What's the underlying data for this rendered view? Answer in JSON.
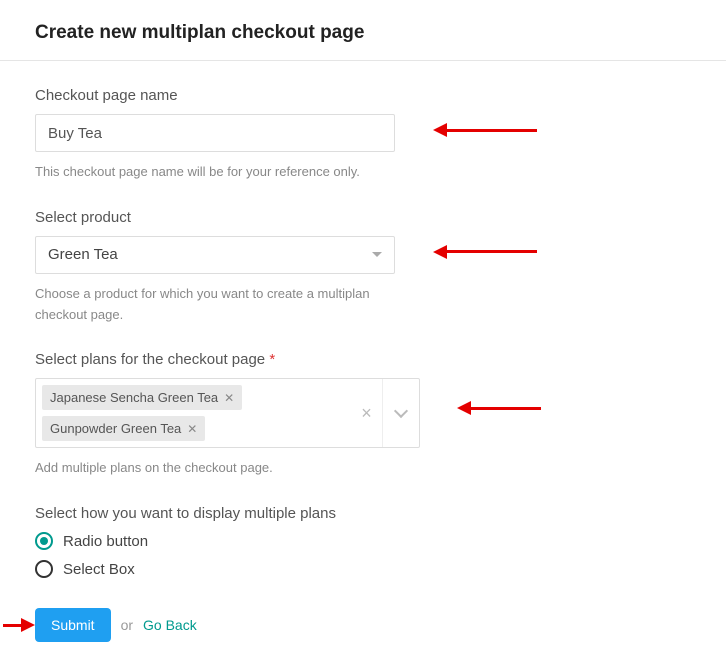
{
  "title": "Create new multiplan checkout page",
  "fields": {
    "name": {
      "label": "Checkout page name",
      "value": "Buy Tea",
      "helper": "This checkout page name will be for your reference only."
    },
    "product": {
      "label": "Select product",
      "value": "Green Tea",
      "helper": "Choose a product for which you want to create a multiplan checkout page."
    },
    "plans": {
      "label": "Select plans for the checkout page",
      "required_mark": "*",
      "tags": [
        "Japanese Sencha Green Tea",
        "Gunpowder Green Tea"
      ],
      "helper": "Add multiple plans on the checkout page."
    },
    "display": {
      "label": "Select how you want to display multiple plans",
      "options": [
        {
          "label": "Radio button",
          "selected": true
        },
        {
          "label": "Select Box",
          "selected": false
        }
      ]
    }
  },
  "actions": {
    "submit": "Submit",
    "or": "or",
    "go_back": "Go Back"
  }
}
